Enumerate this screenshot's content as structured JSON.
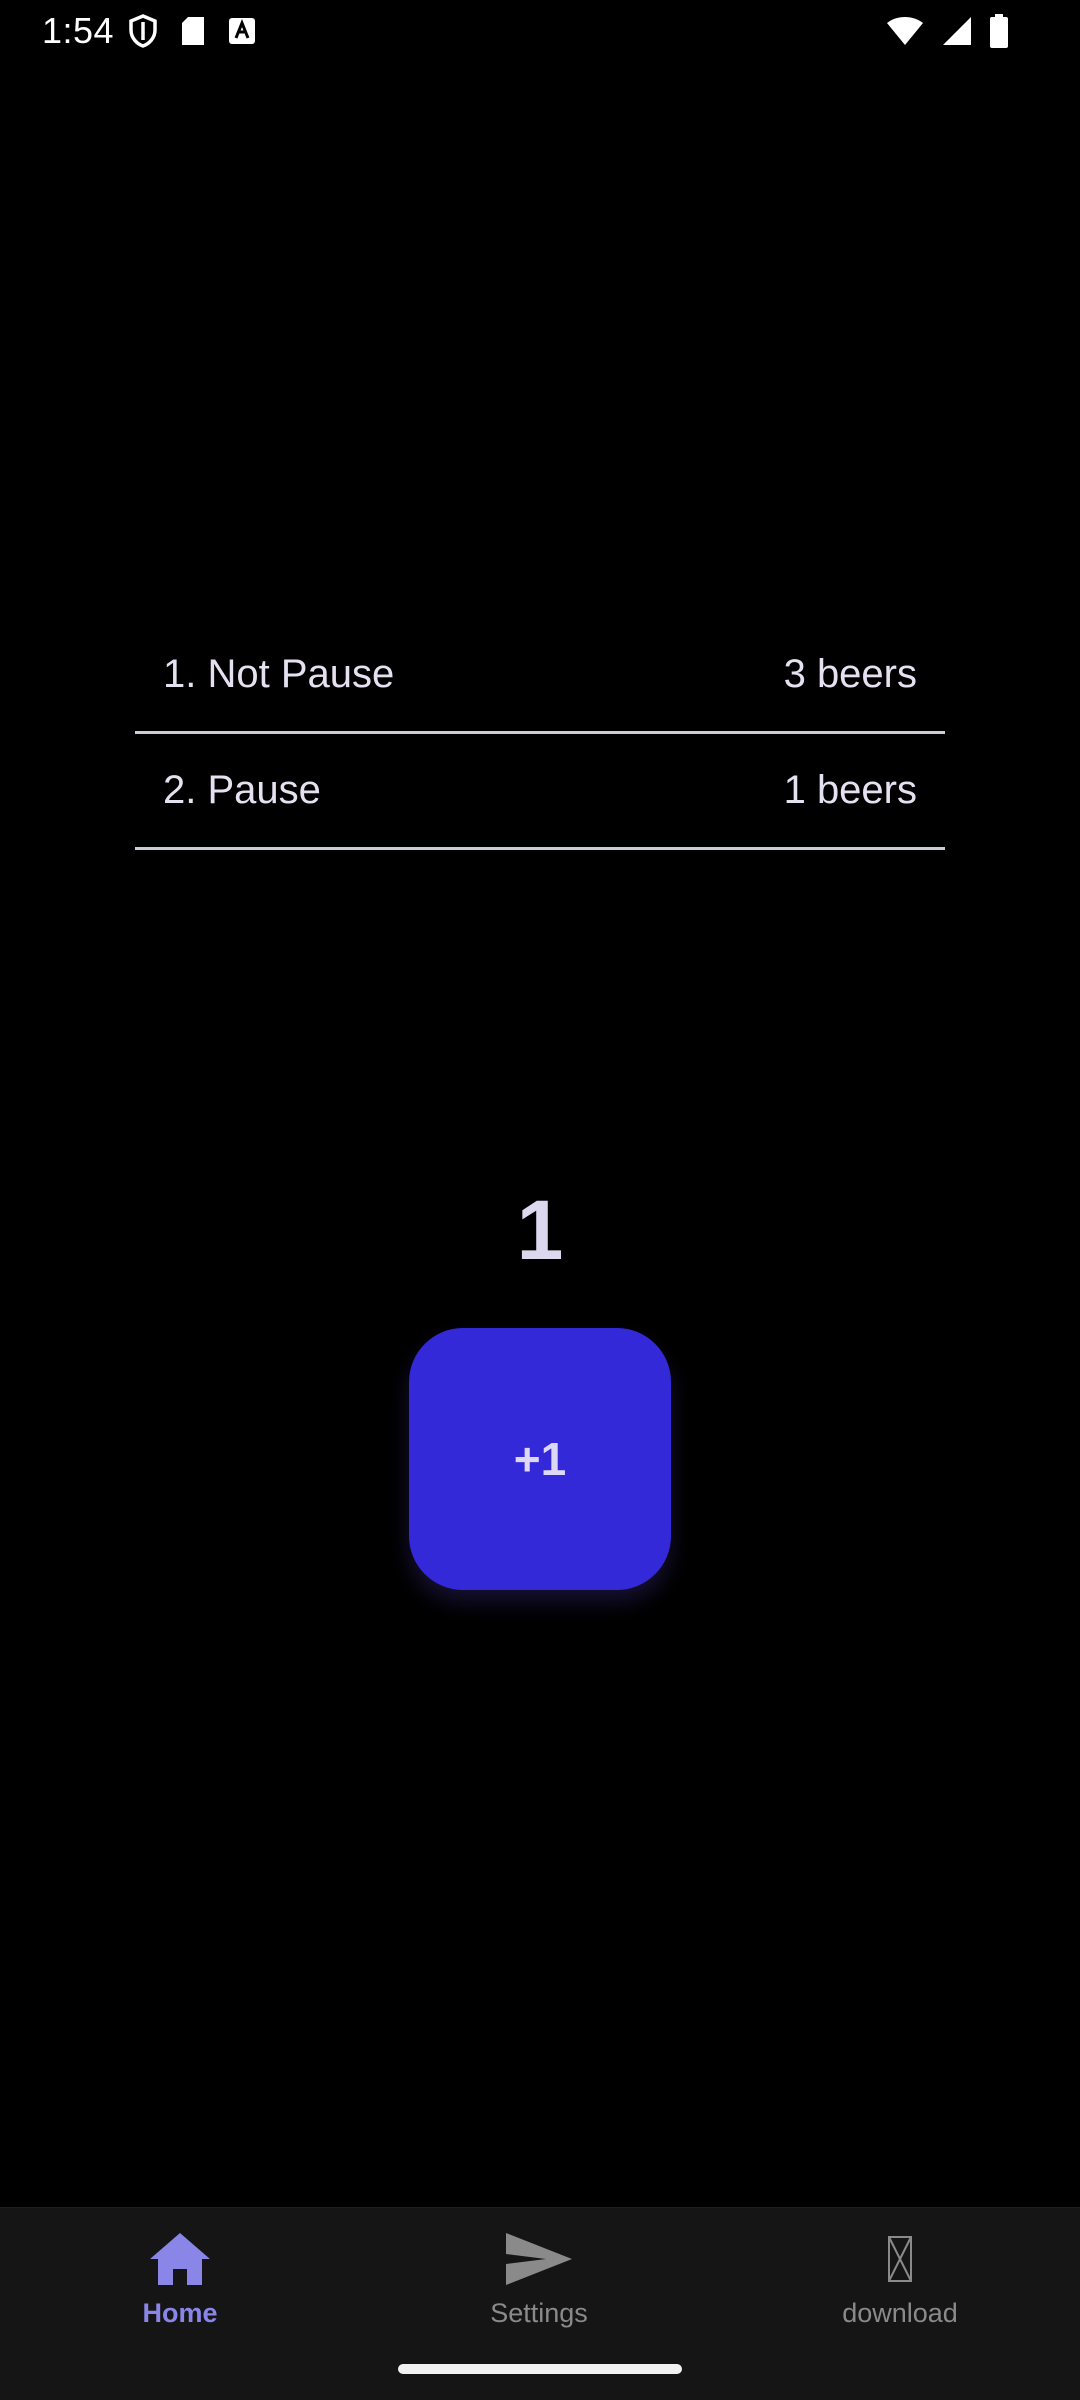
{
  "status_bar": {
    "time": "1:54",
    "left_icons": [
      "shield-icon",
      "sd-card-icon",
      "font-a-icon"
    ],
    "right_icons": [
      "wifi-icon",
      "signal-icon",
      "battery-icon"
    ]
  },
  "leaderboard": {
    "rows": [
      {
        "rank_name": "1. Not Pause",
        "count": "3 beers"
      },
      {
        "rank_name": "2. Pause",
        "count": "1 beers"
      }
    ]
  },
  "counter": {
    "value": "1"
  },
  "action_button": {
    "label": "+1",
    "color": "#3429d8"
  },
  "bottom_nav": {
    "items": [
      {
        "label": "Home",
        "icon": "home-icon",
        "active": true
      },
      {
        "label": "Settings",
        "icon": "send-icon",
        "active": false
      },
      {
        "label": "download",
        "icon": "missing-glyph-icon",
        "active": false
      }
    ],
    "active_color": "#8a86e8",
    "inactive_color": "#8a8a8a"
  }
}
